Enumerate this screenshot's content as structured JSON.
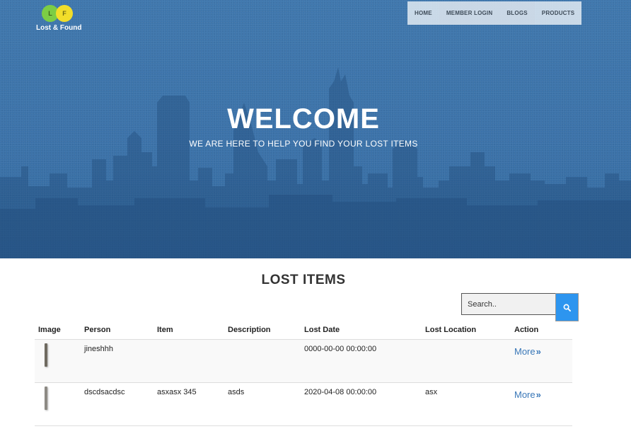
{
  "logo": {
    "letter_left": "L",
    "letter_right": "F",
    "name": "Lost & Found"
  },
  "nav": {
    "items": [
      {
        "label": "HOME"
      },
      {
        "label": "MEMBER LOGIN"
      },
      {
        "label": "BLOGS"
      },
      {
        "label": "PRODUCTS"
      }
    ]
  },
  "hero": {
    "title": "WELCOME",
    "tagline": "WE ARE HERE TO HELP YOU FIND YOUR LOST ITEMS"
  },
  "lost_items": {
    "title": "LOST ITEMS",
    "search": {
      "placeholder": "Search.."
    },
    "columns": [
      "Image",
      "Person",
      "Item",
      "Description",
      "Lost Date",
      "Lost Location",
      "Action"
    ],
    "rows": [
      {
        "person": "jineshhh",
        "item": "",
        "description": "",
        "lost_date": "0000-00-00 00:00:00",
        "lost_location": "",
        "action": "More",
        "action_icon": "»"
      },
      {
        "person": "dscdsacdsc",
        "item": "asxasx 345",
        "description": "asds",
        "lost_date": "2020-04-08 00:00:00",
        "lost_location": "asx",
        "action": "More",
        "action_icon": "»"
      }
    ]
  },
  "colors": {
    "hero_blue": "#3b72a9",
    "accent_button": "#2d95ef",
    "link": "#3a78b8"
  }
}
